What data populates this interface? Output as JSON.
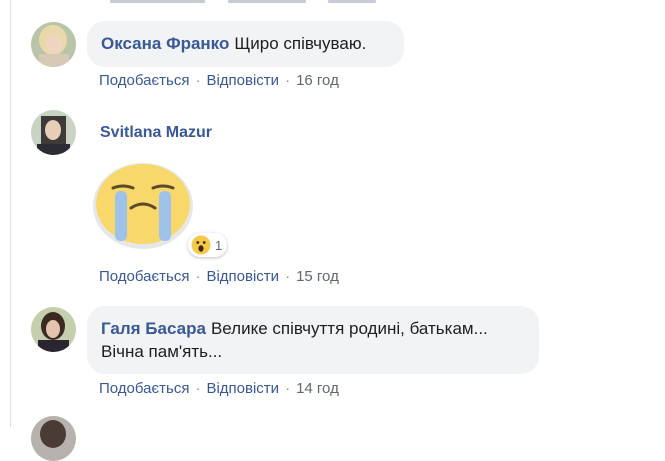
{
  "comments": [
    {
      "author": "Оксана Франко",
      "text": "Щиро співчуваю.",
      "actions": {
        "like": "Подобається",
        "reply": "Відповісти",
        "time": "16 год"
      }
    },
    {
      "author": "Svitlana Mazur",
      "sticker": "crying-face-sticker",
      "reaction": {
        "icon": "wow-reaction-icon",
        "count": "1"
      },
      "actions": {
        "like": "Подобається",
        "reply": "Відповісти",
        "time": "15 год"
      }
    },
    {
      "author": "Галя Басара",
      "text_line1": "Велике співчуття родині, батькам...",
      "text_line2": "Вічна пам'ять...",
      "actions": {
        "like": "Подобається",
        "reply": "Відповісти",
        "time": "14 год"
      }
    }
  ],
  "separator": "·",
  "colors": {
    "author_link": "#385898",
    "meta_text": "#606770",
    "bubble_bg": "#f2f3f5"
  }
}
